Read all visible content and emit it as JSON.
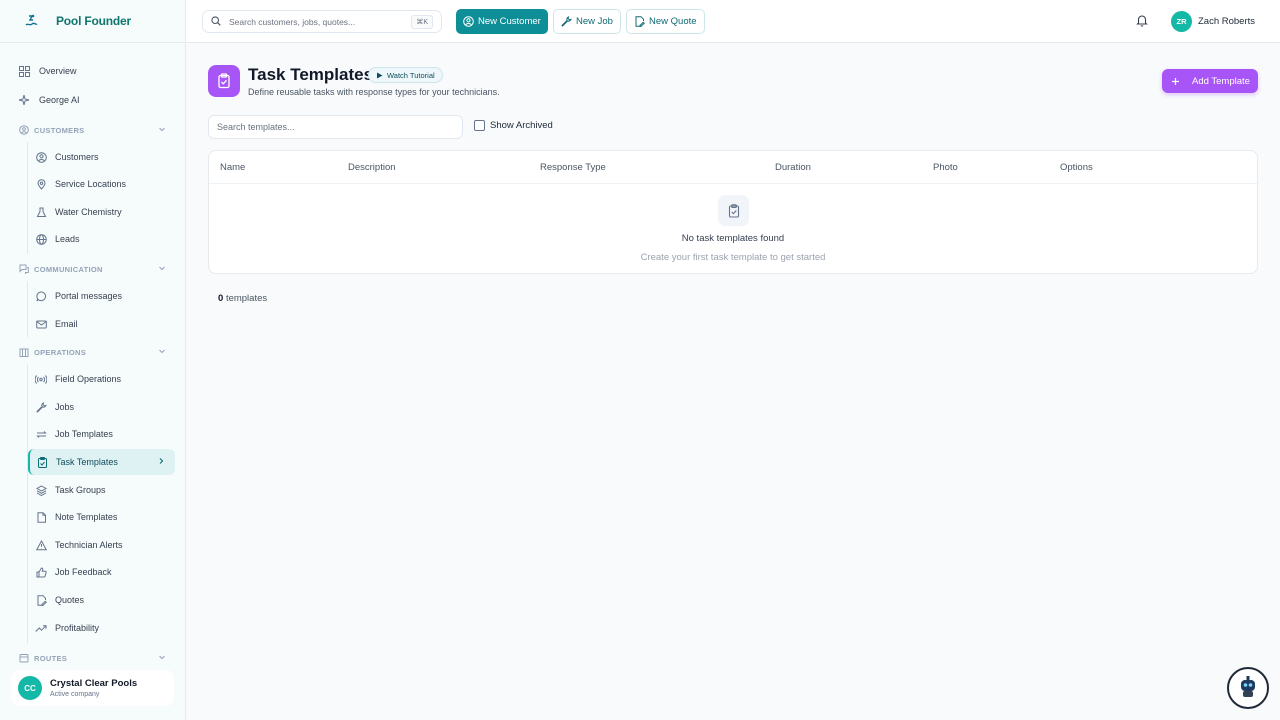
{
  "brand": {
    "name": "Pool Founder"
  },
  "sidebar": {
    "overview": "Overview",
    "george": "George AI",
    "sections": {
      "customers": "CUSTOMERS",
      "communication": "COMMUNICATION",
      "operations": "OPERATIONS",
      "routes": "ROUTES"
    },
    "customers_items": [
      "Customers",
      "Service Locations",
      "Water Chemistry",
      "Leads"
    ],
    "communication_items": [
      "Portal messages",
      "Email"
    ],
    "operations_items": [
      "Field Operations",
      "Jobs",
      "Job Templates",
      "Task Templates",
      "Task Groups",
      "Note Templates",
      "Technician Alerts",
      "Job Feedback",
      "Quotes",
      "Profitability"
    ],
    "active_item": "Task Templates"
  },
  "company": {
    "initials": "CC",
    "name": "Crystal Clear Pools",
    "status": "Active company"
  },
  "topbar": {
    "search_placeholder": "Search customers, jobs, quotes...",
    "shortcut": "⌘K",
    "new_customer": "New Customer",
    "new_job": "New Job",
    "new_quote": "New Quote",
    "user_initials": "ZR",
    "user_name": "Zach Roberts"
  },
  "page": {
    "title": "Task Templates",
    "tutorial": "Watch Tutorial",
    "subtitle": "Define reusable tasks with response types for your technicians.",
    "add_button": "Add Template",
    "search_placeholder": "Search templates...",
    "show_archived": "Show Archived"
  },
  "table": {
    "columns": [
      "Name",
      "Description",
      "Response Type",
      "Duration",
      "Photo",
      "Options"
    ],
    "empty_title": "No task templates found",
    "empty_subtitle": "Create your first task template to get started"
  },
  "footer": {
    "count": "0",
    "count_label": "templates"
  },
  "colors": {
    "teal": "#0e8f98",
    "purple": "#a855f7",
    "accent": "#14b8a6"
  }
}
